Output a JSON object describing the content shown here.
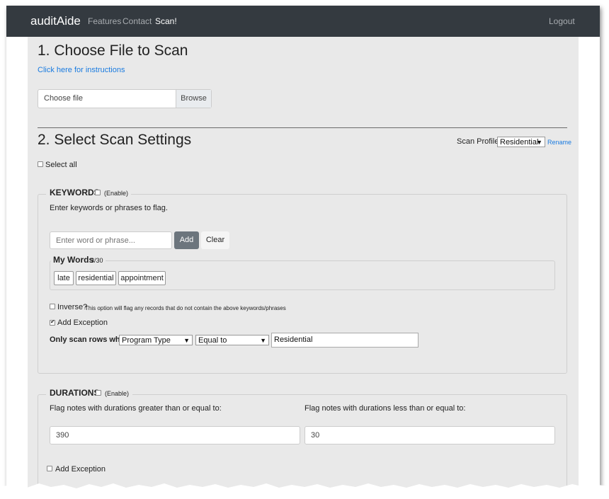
{
  "navbar": {
    "brand": "auditAide",
    "links": [
      "Features",
      "Contact",
      "Scan!"
    ],
    "logout": "Logout"
  },
  "section1": {
    "title": "1. Choose File to Scan",
    "instructions_link": "Click here for instructions",
    "file_placeholder": "Choose file",
    "browse_label": "Browse"
  },
  "section2": {
    "title": "2. Select Scan Settings",
    "scan_profile_label": "Scan Profile:",
    "scan_profile_value": "Residential",
    "rename_label": "Rename",
    "select_all_label": "Select all"
  },
  "keywords": {
    "legend": "KEYWORDS",
    "enable_label": "(Enable)",
    "description": "Enter keywords or phrases to flag.",
    "input_placeholder": "Enter word or phrase...",
    "add_label": "Add",
    "clear_label": "Clear",
    "my_words_label": "My Words",
    "my_words_count": "3/30",
    "words": [
      "late",
      "residential",
      "appointment"
    ],
    "inverse_label": "Inverse?",
    "inverse_note": "This option will flag any records that do not contain the above keywords/phrases",
    "add_exception_label": "Add Exception",
    "add_exception_checked": true,
    "only_scan_label": "Only scan rows where",
    "field_select": "Program Type",
    "operator_select": "Equal to",
    "exception_value": "Residential"
  },
  "durations": {
    "legend": "DURATIONS",
    "enable_label": "(Enable)",
    "greater_label": "Flag notes with durations greater than or equal to:",
    "less_label": "Flag notes with durations less than or equal to:",
    "greater_value": "390",
    "less_value": "30",
    "add_exception_label": "Add Exception"
  },
  "colors": {
    "navbar": "#343a40",
    "link": "#1a7be0",
    "add_button": "#6c757d",
    "content_bg": "#e9e9e9"
  }
}
